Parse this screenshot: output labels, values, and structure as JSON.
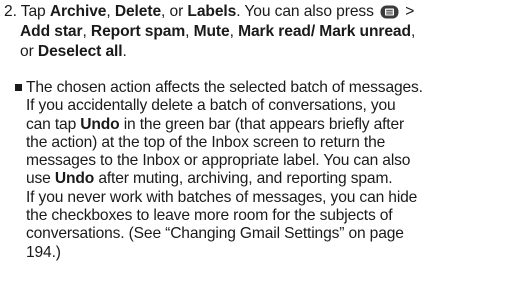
{
  "step": {
    "number": "2.",
    "line1_pre": "Tap ",
    "archive": "Archive",
    "sep1": ", ",
    "delete": "Delete",
    "sep2": ", or ",
    "labels": "Labels",
    "line1_post": ". You can also press",
    "gt": " > ",
    "add_star": "Add star",
    "sep3": ", ",
    "report_spam": "Report spam",
    "sep4": ", ",
    "mute": "Mute",
    "sep5": ", ",
    "mark_read": "Mark read/ Mark unread",
    "sep6": ",",
    "line3_pre": "or ",
    "deselect_all": "Deselect all",
    "line3_post": "."
  },
  "bullet": {
    "lines": [
      "The chosen action affects the selected batch of messages.",
      "If you accidentally delete a batch of conversations, you",
      "can tap ",
      "in the green bar (that appears briefly after",
      "the action) at the top of the Inbox screen to return the",
      "messages to the Inbox or appropriate label. You can also",
      "use ",
      "after muting, archiving, and reporting spam.",
      "If you never work with batches of messages, you can hide",
      "the checkboxes to leave more room for the subjects of",
      "conversations. (See “Changing Gmail Settings” on page",
      "194.)"
    ],
    "undo": "Undo"
  },
  "icons": {
    "menu_key": "menu-key-icon"
  }
}
